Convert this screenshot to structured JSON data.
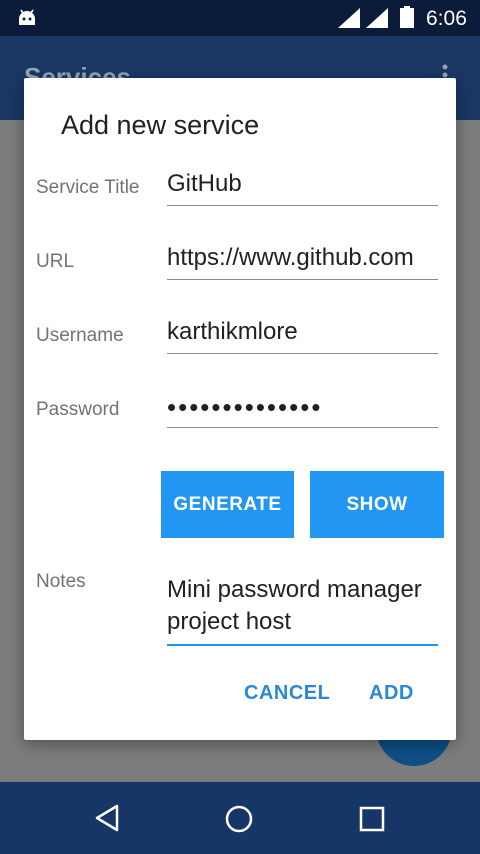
{
  "status_bar": {
    "time": "6:06"
  },
  "app": {
    "title": "Services"
  },
  "dialog": {
    "title": "Add new service",
    "fields": {
      "service_title": {
        "label": "Service Title",
        "value": "GitHub"
      },
      "url": {
        "label": "URL",
        "value": "https://www.github.com"
      },
      "username": {
        "label": "Username",
        "value": "karthikmlore"
      },
      "password": {
        "label": "Password",
        "value": "••••••••••••••"
      },
      "notes": {
        "label": "Notes",
        "value": "Mini password manager project host"
      }
    },
    "buttons": {
      "generate": "GENERATE",
      "show": "SHOW",
      "cancel": "CANCEL",
      "add": "ADD"
    }
  },
  "colors": {
    "accent": "#2196f3",
    "status_bar": "#0a1c3a",
    "nav_bar": "#173668"
  },
  "icons": [
    "android-icon",
    "signal-icon",
    "battery-icon",
    "overflow-menu-icon",
    "back-icon",
    "home-icon",
    "recents-icon"
  ]
}
